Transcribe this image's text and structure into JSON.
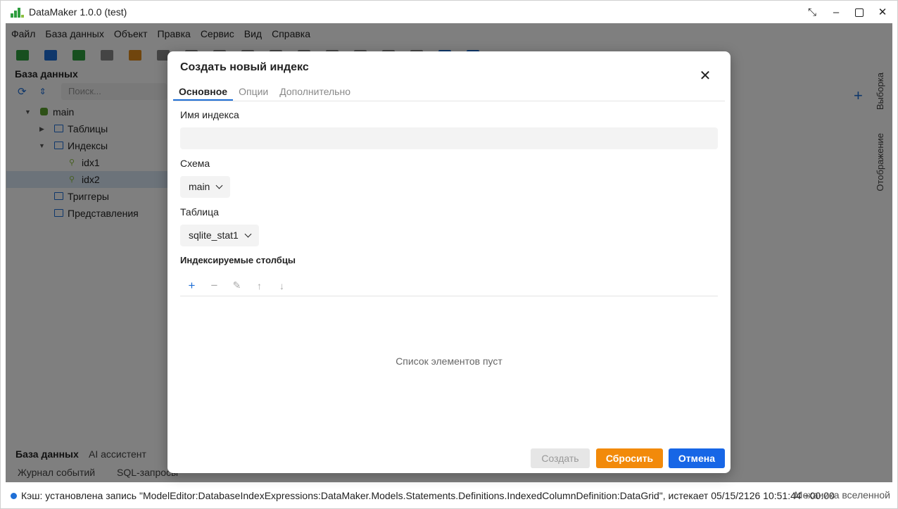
{
  "window": {
    "title": "DataMaker 1.0.0 (test)"
  },
  "menu": [
    "Файл",
    "База данных",
    "Объект",
    "Правка",
    "Сервис",
    "Вид",
    "Справка"
  ],
  "sidebar": {
    "header": "База данных",
    "search_placeholder": "Поиск...",
    "tree": {
      "root": "main",
      "tables": "Таблицы",
      "indexes": "Индексы",
      "idx1": "idx1",
      "idx2": "idx2",
      "triggers": "Триггеры",
      "views": "Представления"
    }
  },
  "right_tabs": {
    "selection": "Выборка",
    "display": "Отображение"
  },
  "bottom_tabs": {
    "database": "База данных",
    "ai": "AI ассистент",
    "events": "Журнал событий",
    "sql": "SQL-запросы"
  },
  "status": {
    "text": "Кэш: установлена запись \"ModelEditor:DatabaseIndexExpressions:DataMaker.Models.Statements.Definitions.IndexedColumnDefinition:DataGrid\", истекает 05/15/2126 10:51:44 +00:00",
    "right": "Механика вселенной"
  },
  "dialog": {
    "title": "Создать новый индекс",
    "tabs": [
      "Основное",
      "Опции",
      "Дополнительно"
    ],
    "index_name_label": "Имя индекса",
    "index_name_value": "",
    "schema_label": "Схема",
    "schema_value": "main",
    "table_label": "Таблица",
    "table_value": "sqlite_stat1",
    "columns_label": "Индексируемые столбцы",
    "empty_message": "Список элементов пуст",
    "buttons": {
      "create": "Создать",
      "reset": "Сбросить",
      "cancel": "Отмена"
    }
  },
  "colors": {
    "accent": "#1766e6",
    "reset": "#f28a0a",
    "tree_icon": "#1f6fd6",
    "db_icon": "#5aa02c",
    "index_icon": "#8cbf3f"
  }
}
